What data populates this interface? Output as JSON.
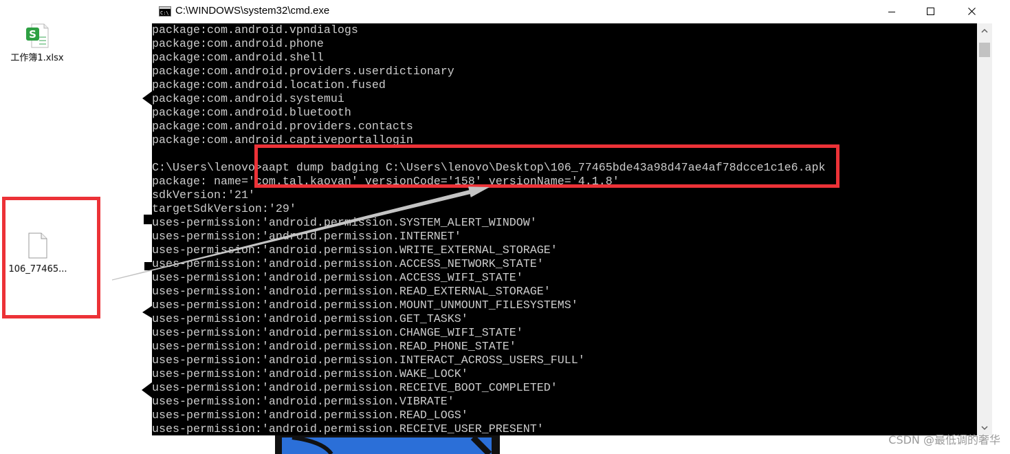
{
  "colors": {
    "desktop_bg": "#ffffff",
    "console_bg": "#000000",
    "console_text": "#cccccc",
    "annotation_red": "#ec3237",
    "arrow_gray": "#c4c4c4",
    "titlebar_bg": "#ffffff",
    "scrollbar_bg": "#f0f0f0",
    "scrollbar_thumb": "#c2c2c2",
    "spreadsheet_green": "#2ea043",
    "watermark_gray": "#9a9a9a"
  },
  "desktop": {
    "icons": [
      {
        "label": "工作簿1.xlsx",
        "icon": "spreadsheet-file-icon",
        "badge": "S"
      },
      {
        "label": "106_77465...",
        "icon": "blank-file-icon"
      }
    ],
    "watermark": "CSDN @最低调的奢华"
  },
  "window": {
    "title": "C:\\WINDOWS\\system32\\cmd.exe",
    "app_icon": "cmd-icon",
    "app_icon_text": "C:\\",
    "controls": [
      {
        "name": "minimize",
        "icon": "minimize-icon"
      },
      {
        "name": "maximize",
        "icon": "maximize-icon"
      },
      {
        "name": "close",
        "icon": "close-icon"
      }
    ]
  },
  "console": {
    "lines": [
      "package:com.android.vpndialogs",
      "package:com.android.phone",
      "package:com.android.shell",
      "package:com.android.providers.userdictionary",
      "package:com.android.location.fused",
      "package:com.android.systemui",
      "package:com.android.bluetooth",
      "package:com.android.providers.contacts",
      "package:com.android.captiveportallogin",
      "",
      "C:\\Users\\lenovo>aapt dump badging C:\\Users\\lenovo\\Desktop\\106_77465bde43a98d47ae4af78dcce1c1e6.apk",
      "package: name='com.tal.kaoyan' versionCode='158' versionName='4.1.8'",
      "sdkVersion:'21'",
      "targetSdkVersion:'29'",
      "uses-permission:'android.permission.SYSTEM_ALERT_WINDOW'",
      "uses-permission:'android.permission.INTERNET'",
      "uses-permission:'android.permission.WRITE_EXTERNAL_STORAGE'",
      "uses-permission:'android.permission.ACCESS_NETWORK_STATE'",
      "uses-permission:'android.permission.ACCESS_WIFI_STATE'",
      "uses-permission:'android.permission.READ_EXTERNAL_STORAGE'",
      "uses-permission:'android.permission.MOUNT_UNMOUNT_FILESYSTEMS'",
      "uses-permission:'android.permission.GET_TASKS'",
      "uses-permission:'android.permission.CHANGE_WIFI_STATE'",
      "uses-permission:'android.permission.READ_PHONE_STATE'",
      "uses-permission:'android.permission.INTERACT_ACROSS_USERS_FULL'",
      "uses-permission:'android.permission.WAKE_LOCK'",
      "uses-permission:'android.permission.RECEIVE_BOOT_COMPLETED'",
      "uses-permission:'android.permission.VIBRATE'",
      "uses-permission:'android.permission.READ_LOGS'",
      "uses-permission:'android.permission.RECEIVE_USER_PRESENT'"
    ]
  },
  "scrollbar": {
    "scroll_position": 0.007,
    "up_icon": "chevron-up-icon",
    "down_icon": "chevron-down-icon"
  }
}
